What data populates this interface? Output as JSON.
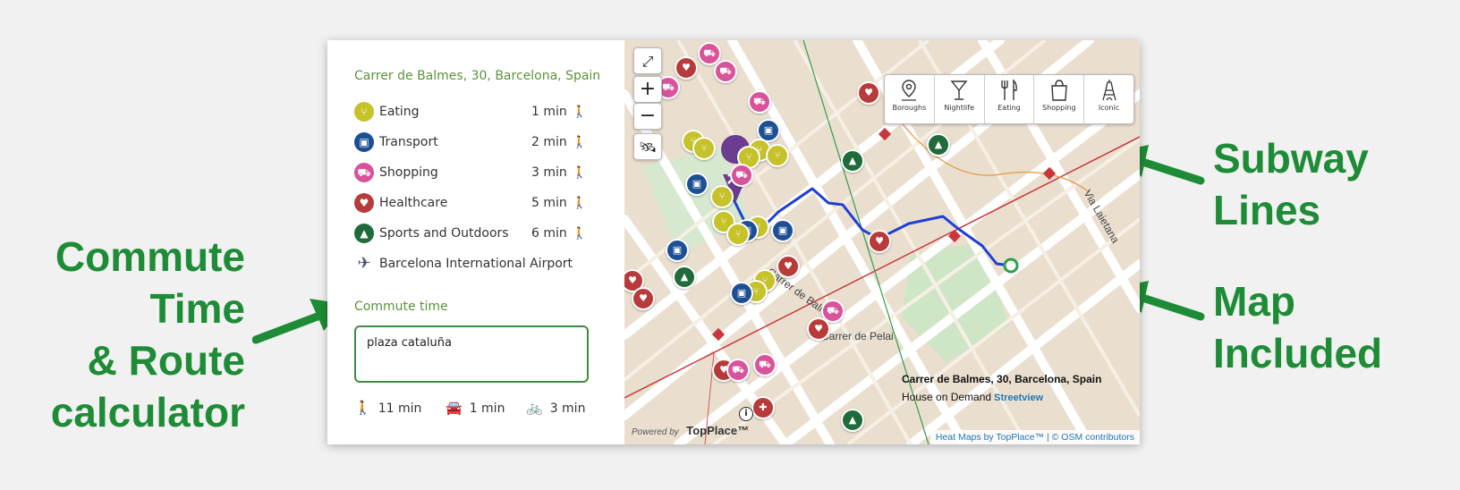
{
  "callouts": {
    "left": [
      "Commute",
      "Time",
      "& Route",
      "calculator"
    ],
    "subway": [
      "Subway",
      "Lines"
    ],
    "map": [
      "Map",
      "Included"
    ]
  },
  "panel": {
    "address": "Carrer de Balmes, 30, Barcelona, Spain",
    "pois": [
      {
        "label": "Eating",
        "time": "1 min",
        "icon": "fork-knife-icon",
        "color": "#c6c22a"
      },
      {
        "label": "Transport",
        "time": "2 min",
        "icon": "bus-icon",
        "color": "#1c4f94"
      },
      {
        "label": "Shopping",
        "time": "3 min",
        "icon": "cart-icon",
        "color": "#d9539a"
      },
      {
        "label": "Healthcare",
        "time": "5 min",
        "icon": "heart-cross-icon",
        "color": "#b83b3b"
      },
      {
        "label": "Sports and Outdoors",
        "time": "6 min",
        "icon": "tree-icon",
        "color": "#1f6b3a"
      },
      {
        "label": "Barcelona International Airport",
        "time": "",
        "icon": "airplane-icon",
        "color": "#4a5568"
      }
    ],
    "commute_label": "Commute time",
    "commute_value": "plaza cataluña",
    "travel": {
      "walk": "11 min",
      "car": "1 min",
      "bike": "3 min"
    }
  },
  "map": {
    "categories": [
      {
        "label": "Boroughs",
        "icon": "map-pin-icon"
      },
      {
        "label": "Nightlife",
        "icon": "cocktail-icon"
      },
      {
        "label": "Eating",
        "icon": "fork-knife-icon"
      },
      {
        "label": "Shopping",
        "icon": "shopping-bag-icon"
      },
      {
        "label": "Iconic",
        "icon": "eiffel-tower-icon"
      }
    ],
    "info_title": "Carrer de Balmes, 30, Barcelona, Spain",
    "info_sub": "House on Demand",
    "streetview": "Streetview",
    "attribution": "Heat Maps by TopPlace™ | © OSM contributors",
    "powered_by": "Powered by",
    "brand": "TopPlace™",
    "streets": [
      "Carrer de Pelai",
      "Carrer de Balmes",
      "Via Laietana"
    ],
    "colors": {
      "route": "#1f3fd6",
      "subway_red": "#c9363b",
      "subway_green": "#2e9e4a",
      "subway_orange": "#e6963b"
    }
  }
}
